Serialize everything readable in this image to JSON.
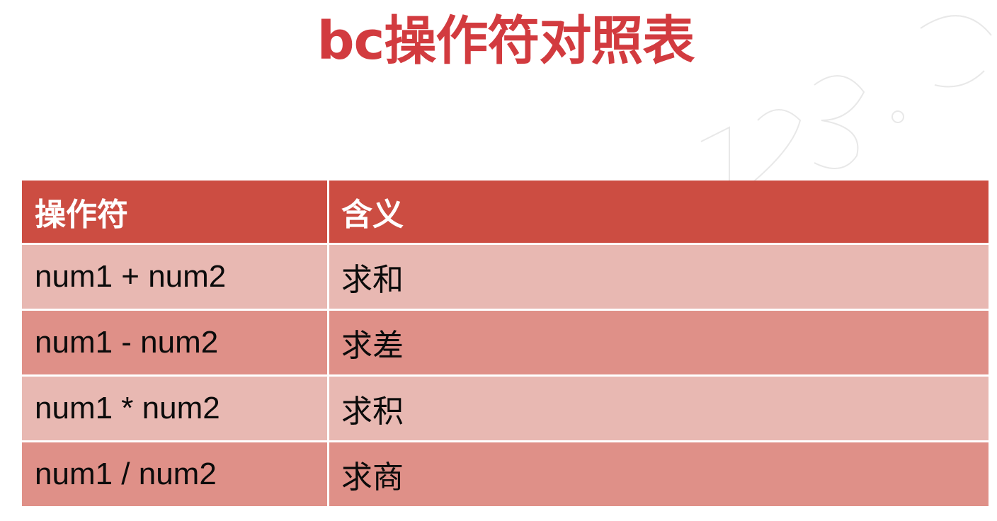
{
  "title": "bc操作符对照表",
  "table": {
    "headers": [
      "操作符",
      "含义"
    ],
    "rows": [
      {
        "operator": "num1 + num2",
        "meaning": "求和"
      },
      {
        "operator": "num1 - num2",
        "meaning": "求差"
      },
      {
        "operator": "num1 * num2",
        "meaning": "求积"
      },
      {
        "operator": "num1 / num2",
        "meaning": "求商"
      }
    ]
  },
  "colors": {
    "title": "#d23b3f",
    "header_bg": "#cc4d42",
    "row_light": "#e8b8b2",
    "row_dark": "#df9088"
  }
}
